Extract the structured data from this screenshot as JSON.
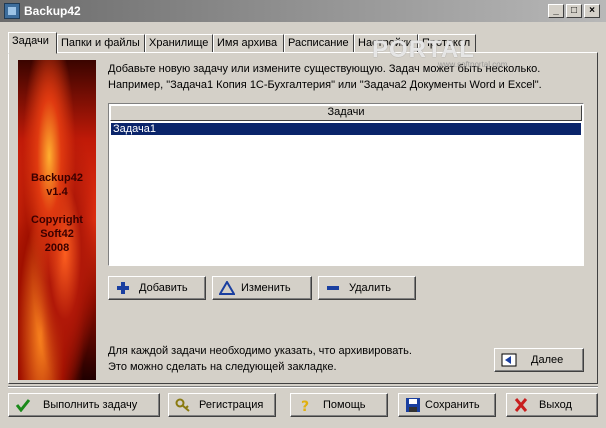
{
  "window": {
    "title": "Backup42",
    "minimize_glyph": "_",
    "maximize_glyph": "□",
    "close_glyph": "×"
  },
  "tabs": [
    {
      "label": "Задачи",
      "active": true
    },
    {
      "label": "Папки и файлы"
    },
    {
      "label": "Хранилище"
    },
    {
      "label": "Имя архива"
    },
    {
      "label": "Расписание"
    },
    {
      "label": "Настройки"
    },
    {
      "label": "Протокол"
    }
  ],
  "splash": {
    "app": "Backup42",
    "version": "v1.4",
    "copyright": "Copyright",
    "company": "Soft42",
    "year": "2008"
  },
  "info": {
    "line1": "Добавьте новую задачу или измените существующую. Задач может быть несколько.",
    "line2": "Например, \"Задача1 Копия 1С-Бухгалтерия\" или \"Задача2 Документы Word и Excel\"."
  },
  "task_list": {
    "header": "Задачи",
    "items": [
      "Задача1"
    ],
    "selected_index": 0
  },
  "task_buttons": {
    "add": "Добавить",
    "edit": "Изменить",
    "delete": "Удалить"
  },
  "hint": {
    "line1": "Для каждой задачи необходимо указать, что архивировать.",
    "line2": "Это можно сделать на следующей закладке."
  },
  "next_button": "Далее",
  "bottom_buttons": {
    "run": "Выполнить задачу",
    "register": "Регистрация",
    "help": "Помощь",
    "save": "Сохранить",
    "exit": "Выход"
  },
  "watermark": {
    "text": "PORTAL",
    "url": "www.softportal.com"
  },
  "icons": {
    "add": "plus-icon",
    "edit": "triangle-icon",
    "delete": "minus-icon",
    "next": "next-icon",
    "run": "checkmark-icon",
    "register": "key-icon",
    "help": "question-icon",
    "save": "floppy-icon",
    "exit": "x-icon"
  },
  "colors": {
    "selection": "#0a246a",
    "window_bg": "#d4d0c8",
    "accent_blue": "#1a3fa0",
    "run_green": "#1a8a1a",
    "exit_red": "#c81e1e"
  }
}
